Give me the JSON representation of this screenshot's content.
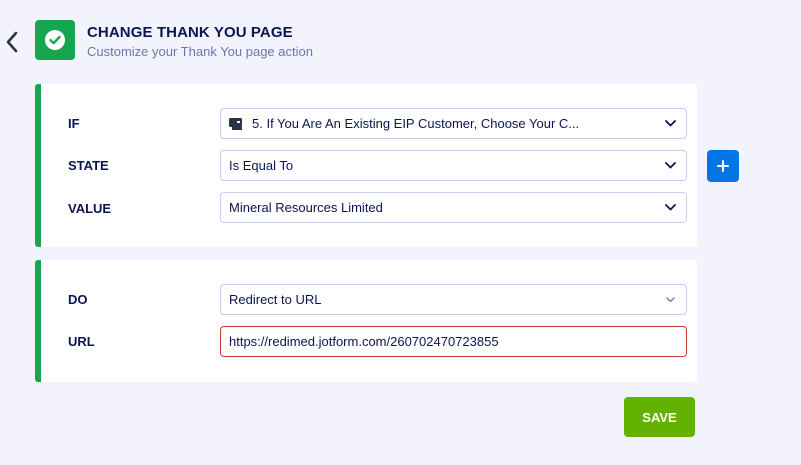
{
  "header": {
    "title": "CHANGE THANK YOU PAGE",
    "subtitle": "Customize your Thank You page action"
  },
  "condition": {
    "if_label": "IF",
    "if_value": "5. If You Are An Existing EIP Customer, Choose Your C...",
    "state_label": "STATE",
    "state_value": "Is Equal To",
    "value_label": "VALUE",
    "value_value": "Mineral Resources Limited"
  },
  "action": {
    "do_label": "DO",
    "do_value": "Redirect to URL",
    "url_label": "URL",
    "url_value": "https://redimed.jotform.com/260702470723855"
  },
  "buttons": {
    "add": "+",
    "save": "SAVE"
  },
  "icons": {
    "back": "chevron-left-icon",
    "header": "check-circle-icon",
    "field": "dropdown-field-icon",
    "chevron": "chevron-down-icon",
    "add": "plus-icon"
  },
  "colors": {
    "accent_green": "#18a550",
    "save_green": "#64b200",
    "add_blue": "#0075e3",
    "error_red": "#c43b3b",
    "background": "#f3f3fe"
  }
}
